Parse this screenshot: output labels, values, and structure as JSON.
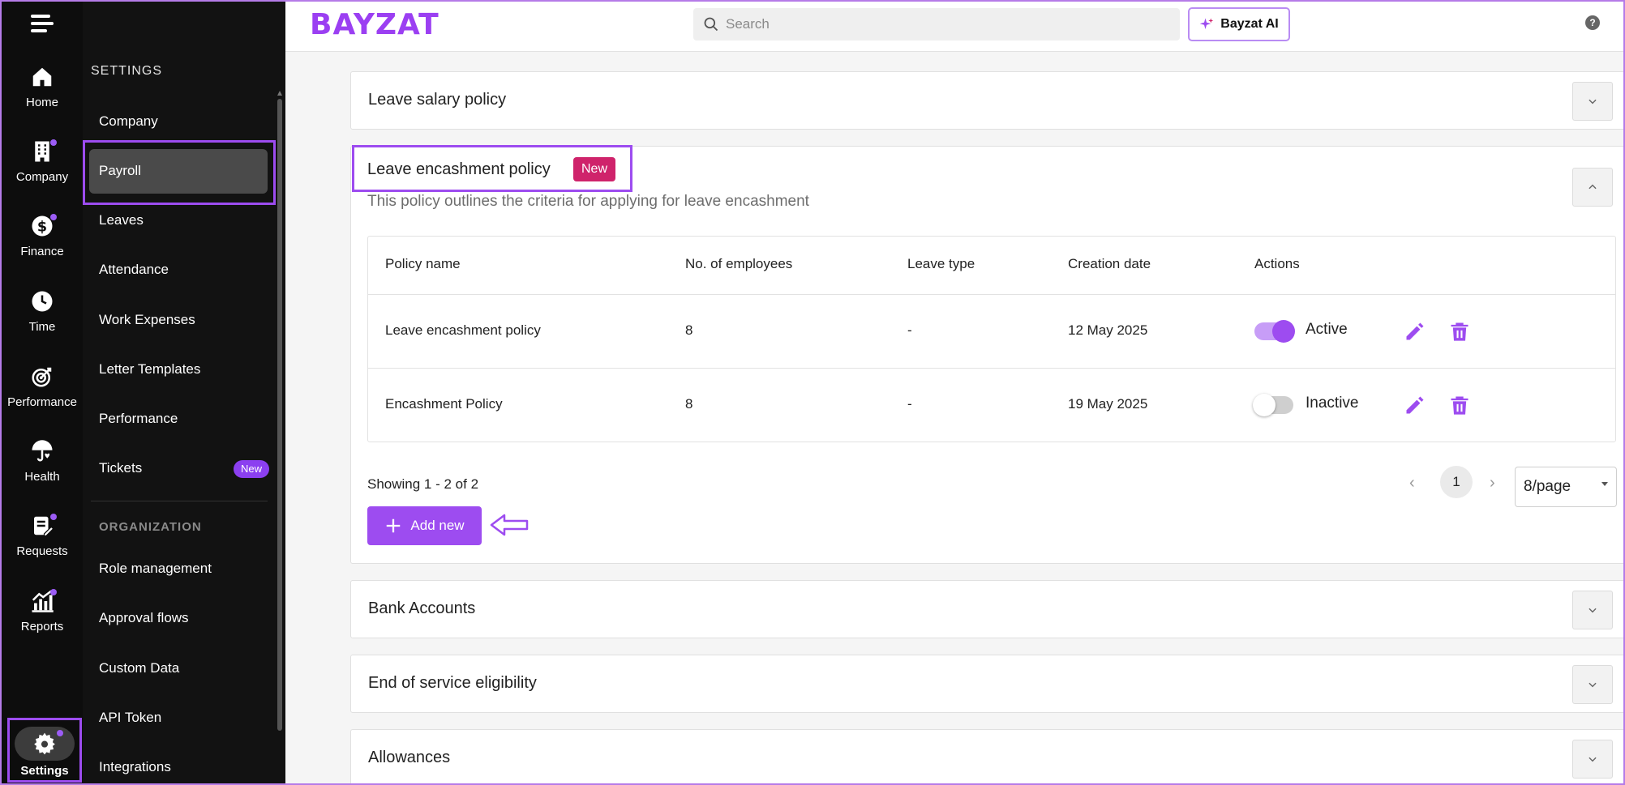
{
  "app": {
    "brand": "BAYZAT"
  },
  "rail": {
    "items": [
      {
        "label": "Home",
        "icon": "home-icon",
        "dot": false
      },
      {
        "label": "Company",
        "icon": "building-icon",
        "dot": true
      },
      {
        "label": "Finance",
        "icon": "dollar-icon",
        "dot": true
      },
      {
        "label": "Time",
        "icon": "clock-icon",
        "dot": false
      },
      {
        "label": "Performance",
        "icon": "target-icon",
        "dot": false
      },
      {
        "label": "Health",
        "icon": "umbrella-heart-icon",
        "dot": false
      },
      {
        "label": "Requests",
        "icon": "clipboard-icon",
        "dot": true
      },
      {
        "label": "Reports",
        "icon": "bar-chart-icon",
        "dot": true
      }
    ],
    "settings_label": "Settings"
  },
  "sidebar": {
    "heading": "SETTINGS",
    "items": [
      {
        "label": "Company"
      },
      {
        "label": "Payroll"
      },
      {
        "label": "Leaves"
      },
      {
        "label": "Attendance"
      },
      {
        "label": "Work Expenses"
      },
      {
        "label": "Letter Templates"
      },
      {
        "label": "Performance"
      },
      {
        "label": "Tickets",
        "badge": "New"
      }
    ],
    "org_heading": "ORGANIZATION",
    "org_items": [
      {
        "label": "Role management"
      },
      {
        "label": "Approval flows"
      },
      {
        "label": "Custom Data"
      },
      {
        "label": "API Token"
      },
      {
        "label": "Integrations"
      }
    ]
  },
  "topbar": {
    "search_placeholder": "Search",
    "ai_label": "Bayzat AI",
    "help": "?"
  },
  "sections": {
    "leave_salary": {
      "title": "Leave salary policy"
    },
    "encashment": {
      "title": "Leave encashment policy",
      "badge": "New",
      "description": "This policy outlines the criteria for applying for leave encashment"
    },
    "bank_accounts": {
      "title": "Bank Accounts"
    },
    "end_of_service": {
      "title": "End of service eligibility"
    },
    "allowances": {
      "title": "Allowances"
    }
  },
  "table": {
    "columns": [
      "Policy name",
      "No. of employees",
      "Leave type",
      "Creation date",
      "Actions"
    ],
    "rows": [
      {
        "name": "Leave encashment policy",
        "employees": "8",
        "leave_type": "-",
        "date": "12 May 2025",
        "status": "Active",
        "active": true
      },
      {
        "name": "Encashment Policy",
        "employees": "8",
        "leave_type": "-",
        "date": "19 May 2025",
        "status": "Inactive",
        "active": false
      }
    ]
  },
  "pagination": {
    "showing": "Showing 1 - 2 of 2",
    "page": "1",
    "per_page": "8/page"
  },
  "actions": {
    "add_new": "Add new"
  },
  "colors": {
    "accent": "#9d4cf0",
    "new_badge": "#cf236b",
    "rail_bg": "#0d0d0d"
  }
}
